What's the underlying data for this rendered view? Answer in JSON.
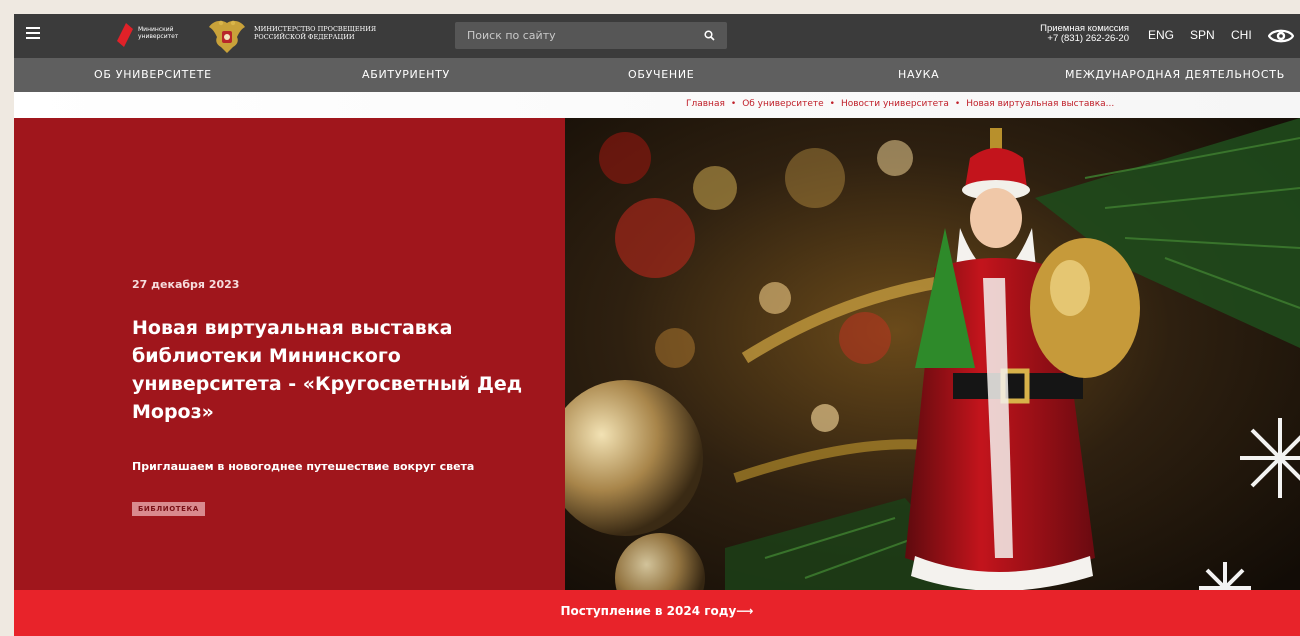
{
  "header": {
    "logo_text_line1": "Мининский",
    "logo_text_line2": "университет",
    "ministry_line1": "МИНИСТЕРСТВО ПРОСВЕЩЕНИЯ",
    "ministry_line2": "РОССИЙСКОЙ ФЕДЕРАЦИИ",
    "search_placeholder": "Поиск по сайту",
    "admission_label": "Приемная комиссия",
    "admission_phone": "+7 (831) 262-26-20",
    "languages": [
      "ENG",
      "SPN",
      "CHI"
    ]
  },
  "nav": {
    "items": [
      "ОБ УНИВЕРСИТЕТЕ",
      "АБИТУРИЕНТУ",
      "ОБУЧЕНИЕ",
      "НАУКА",
      "МЕЖДУНАРОДНАЯ ДЕЯТЕЛЬНОСТЬ"
    ]
  },
  "breadcrumb": {
    "items": [
      "Главная",
      "Об университете",
      "Новости университета",
      "Новая виртуальная выставка..."
    ],
    "separator": "•"
  },
  "hero": {
    "date": "27 декабря 2023",
    "title": "Новая виртуальная выставка библиотеки Мининского университета - «Кругосветный Дед Мороз»",
    "subtitle": "Приглашаем в новогоднее путешествие вокруг света",
    "tag": "БИБЛИОТЕКА"
  },
  "banner": {
    "text": "Поступление в 2024 году⟶"
  },
  "colors": {
    "topbar": "#3b3b3b",
    "nav": "#5f5f5f",
    "hero_red": "#a0161c",
    "banner_red": "#e8232a",
    "breadcrumb_red": "#c0202a"
  }
}
